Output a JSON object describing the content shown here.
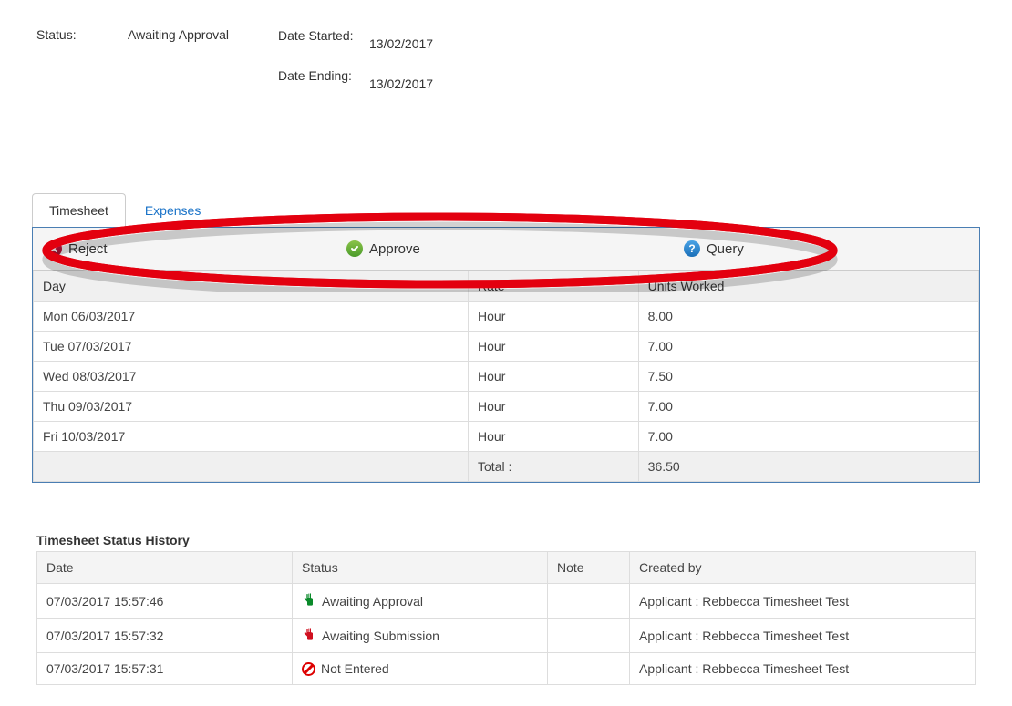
{
  "header": {
    "status_label": "Status:",
    "status_value": "Awaiting Approval",
    "date_started_label": "Date Started:",
    "date_started_value": "13/02/2017",
    "date_ending_label": "Date Ending:",
    "date_ending_value": "13/02/2017"
  },
  "tabs": {
    "timesheet": "Timesheet",
    "expenses": "Expenses"
  },
  "actions": {
    "reject": "Reject",
    "approve": "Approve",
    "query": "Query"
  },
  "timesheet_table": {
    "headers": {
      "day": "Day",
      "rate": "Rate",
      "units": "Units Worked"
    },
    "rows": [
      {
        "day": "Mon 06/03/2017",
        "rate": "Hour",
        "units": "8.00"
      },
      {
        "day": "Tue 07/03/2017",
        "rate": "Hour",
        "units": "7.00"
      },
      {
        "day": "Wed 08/03/2017",
        "rate": "Hour",
        "units": "7.50"
      },
      {
        "day": "Thu 09/03/2017",
        "rate": "Hour",
        "units": "7.00"
      },
      {
        "day": "Fri 10/03/2017",
        "rate": "Hour",
        "units": "7.00"
      }
    ],
    "total_label": "Total :",
    "total_value": "36.50"
  },
  "history": {
    "title": "Timesheet Status History",
    "headers": {
      "date": "Date",
      "status": "Status",
      "note": "Note",
      "by": "Created by"
    },
    "rows": [
      {
        "date": "07/03/2017 15:57:46",
        "status": "Awaiting Approval",
        "icon": "hand-green",
        "note": "",
        "by": "Applicant : Rebbecca Timesheet Test"
      },
      {
        "date": "07/03/2017 15:57:32",
        "status": "Awaiting Submission",
        "icon": "hand-red",
        "note": "",
        "by": "Applicant : Rebbecca Timesheet Test"
      },
      {
        "date": "07/03/2017 15:57:31",
        "status": "Not Entered",
        "icon": "forbid",
        "note": "",
        "by": "Applicant : Rebbecca Timesheet Test"
      }
    ]
  }
}
